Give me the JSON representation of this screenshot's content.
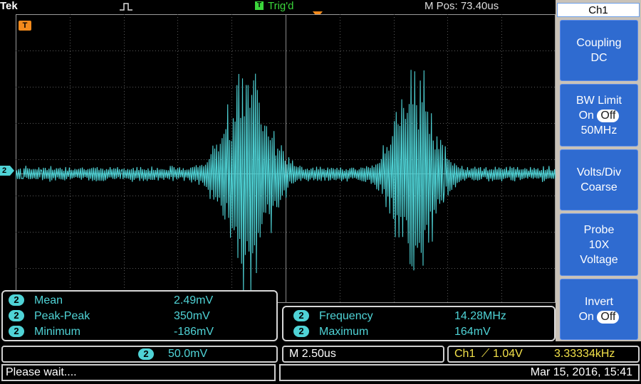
{
  "topbar": {
    "brand": "Tek",
    "acquire_icon": "single-pulse-icon",
    "trigger_box": "T",
    "trigger_status": "Trig'd",
    "position": "M Pos: 73.40us"
  },
  "screen": {
    "channel_marker": "2",
    "trigger_marker": "T",
    "trace_color": "#4fd3d6",
    "trigger_color": "#f28a1c"
  },
  "menu": {
    "title": "Ch1",
    "coupling": {
      "line1": "Coupling",
      "line2": "DC"
    },
    "bw_limit": {
      "line1": "BW Limit",
      "on": "On",
      "off": "Off",
      "line3": "50MHz"
    },
    "volts_div": {
      "line1": "Volts/Div",
      "line2": "Coarse"
    },
    "probe": {
      "line1": "Probe",
      "line2": "10X",
      "line3": "Voltage"
    },
    "invert": {
      "line1": "Invert",
      "on": "On",
      "off": "Off"
    }
  },
  "measurements_left": [
    {
      "badge": "2",
      "label": "Mean",
      "value": "2.49mV"
    },
    {
      "badge": "2",
      "label": "Peak-Peak",
      "value": "350mV"
    },
    {
      "badge": "2",
      "label": "Minimum",
      "value": "-186mV"
    }
  ],
  "measurements_right": [
    {
      "badge": "2",
      "label": "Frequency",
      "value": "14.28MHz"
    },
    {
      "badge": "2",
      "label": "Maximum",
      "value": "164mV"
    }
  ],
  "bottom": {
    "ch_badge": "2",
    "ch_scale": "50.0mV",
    "timebase": "M 2.50us",
    "trigger_source": "Ch1",
    "trigger_slope": "⟋",
    "trigger_level": "1.04V",
    "trigger_freq": "3.33334kHz"
  },
  "status": {
    "message": "Please wait....",
    "datetime": "Mar 15, 2016, 15:41"
  }
}
